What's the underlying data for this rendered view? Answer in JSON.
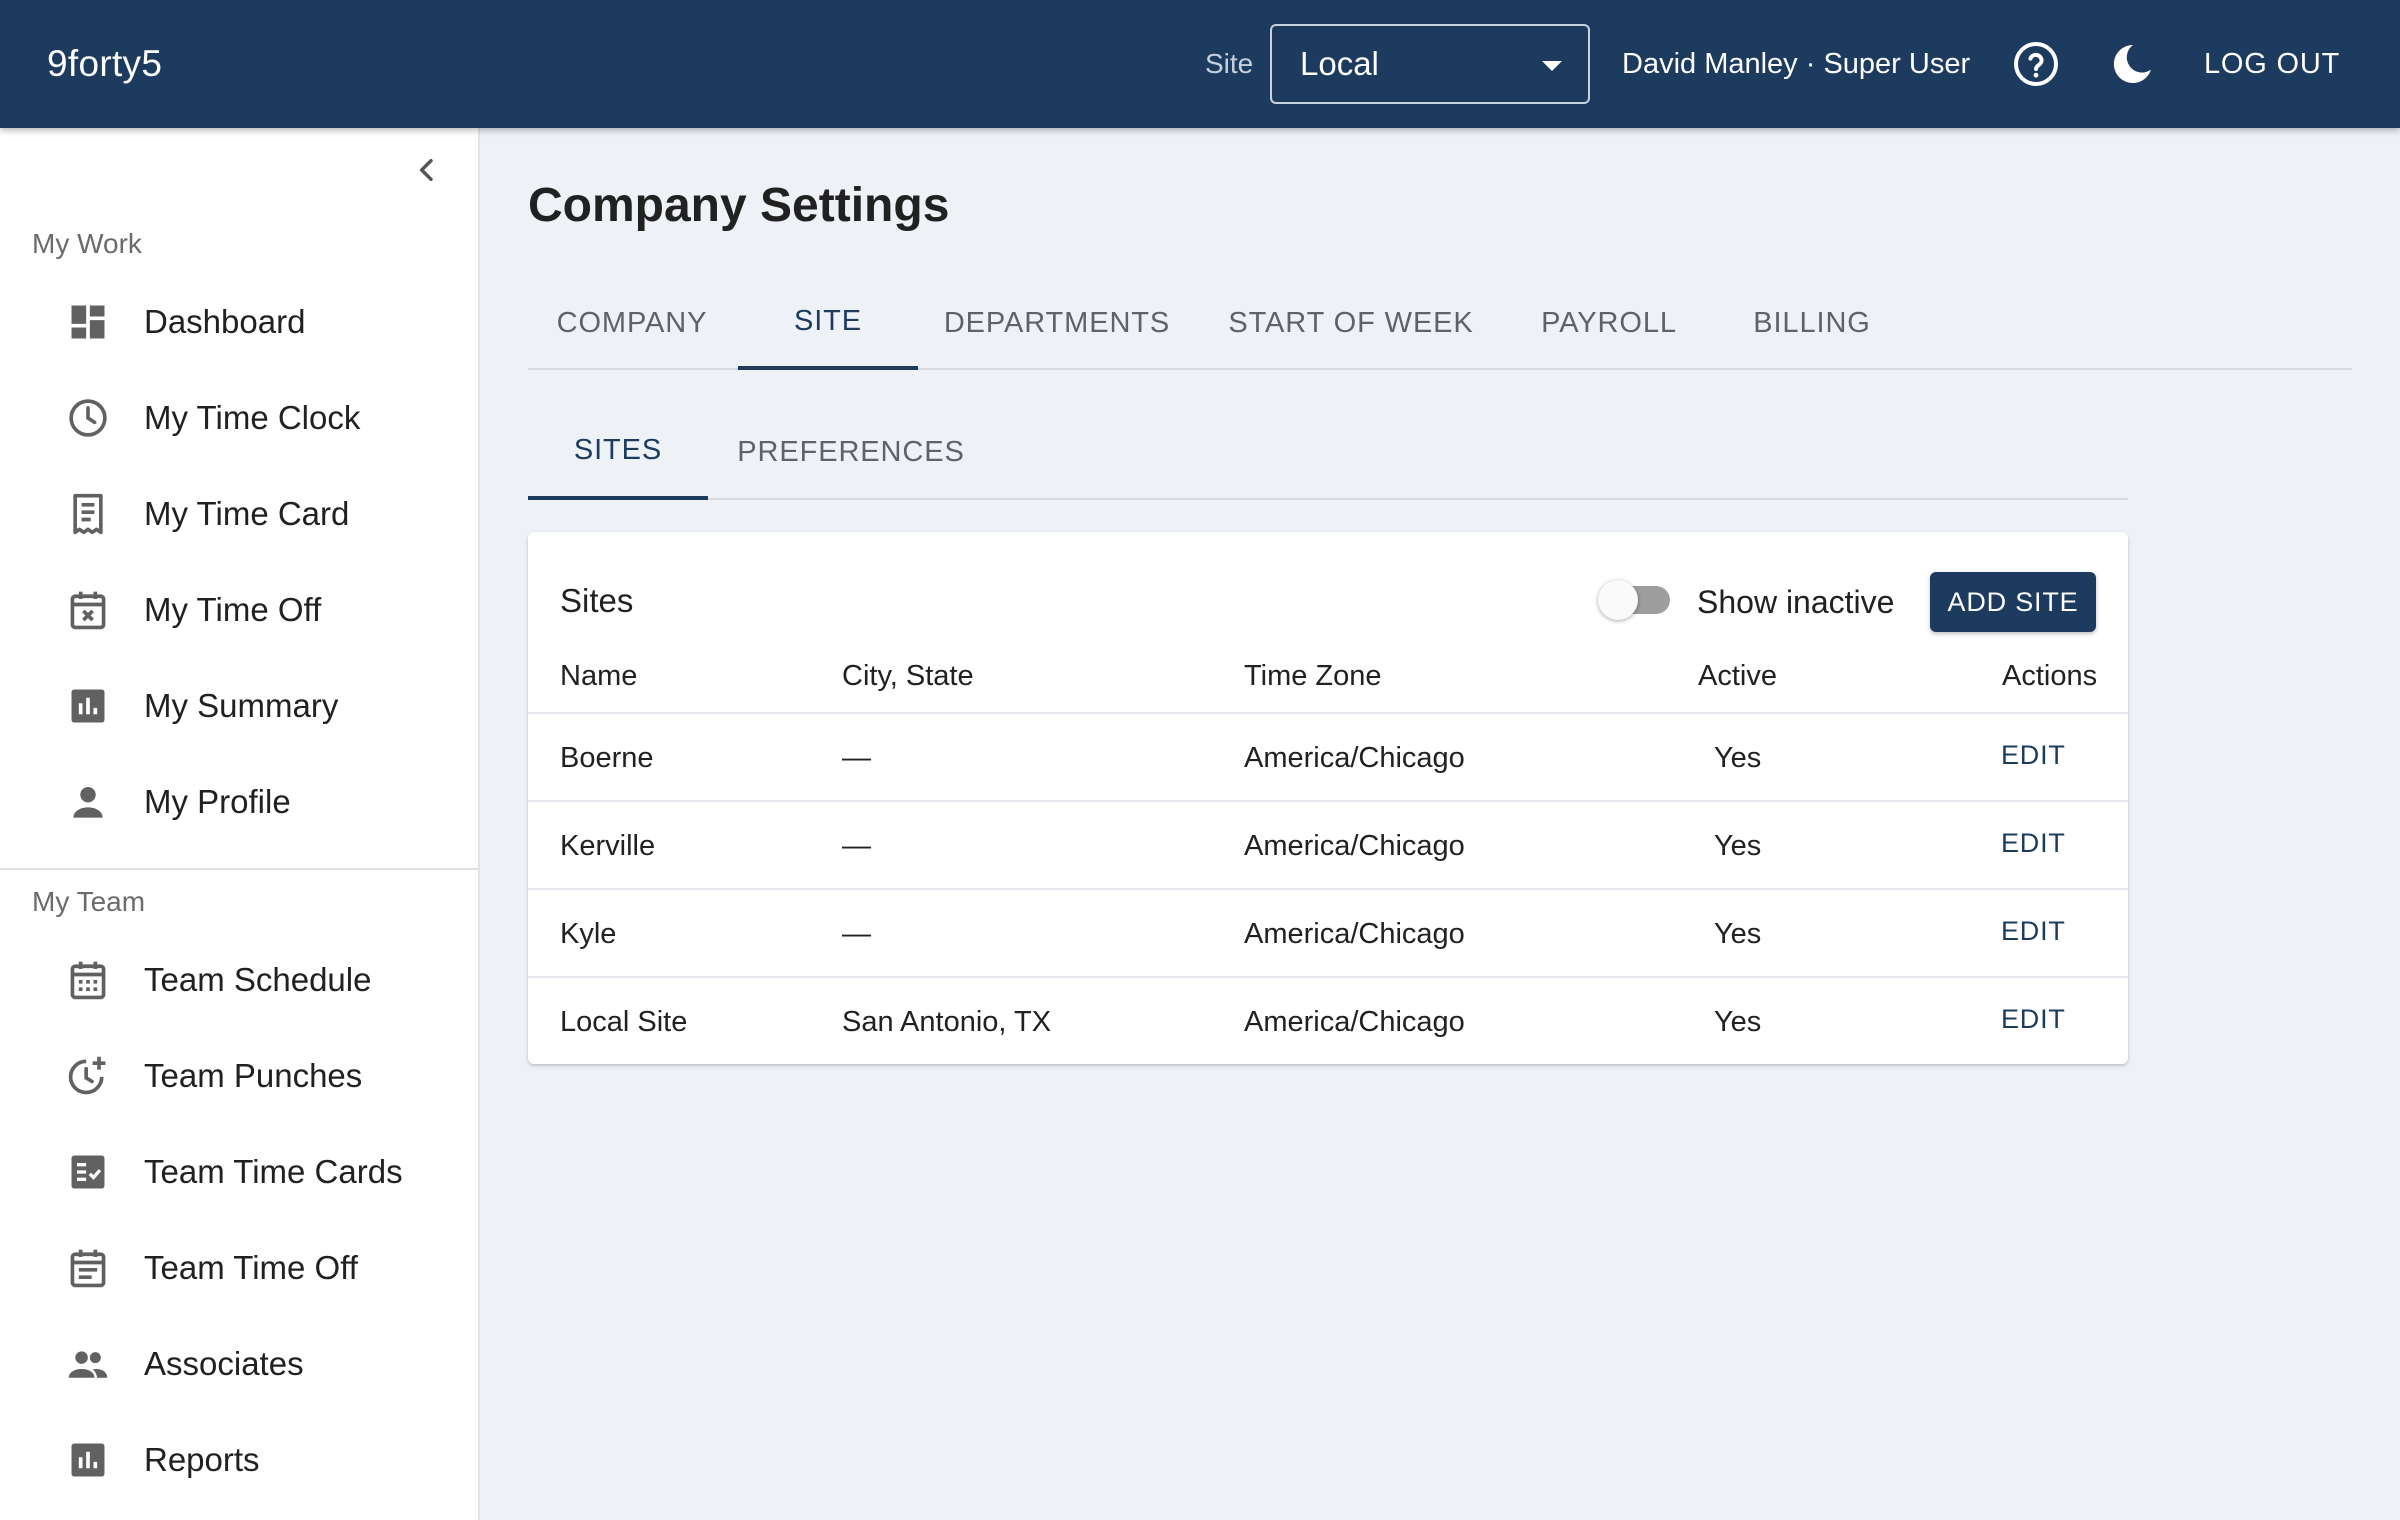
{
  "app": {
    "brand": "9forty5"
  },
  "header": {
    "site_label": "Site",
    "site_value": "Local",
    "user": "David Manley · Super User",
    "logout_label": "LOG OUT"
  },
  "sidebar": {
    "my_work_title": "My Work",
    "my_work": [
      {
        "label": "Dashboard",
        "icon": "dashboard-icon"
      },
      {
        "label": "My Time Clock",
        "icon": "clock-icon"
      },
      {
        "label": "My Time Card",
        "icon": "receipt-icon"
      },
      {
        "label": "My Time Off",
        "icon": "calendar-x-icon"
      },
      {
        "label": "My Summary",
        "icon": "bar-chart-icon"
      },
      {
        "label": "My Profile",
        "icon": "person-icon"
      }
    ],
    "my_team_title": "My Team",
    "my_team": [
      {
        "label": "Team Schedule",
        "icon": "calendar-grid-icon"
      },
      {
        "label": "Team Punches",
        "icon": "clock-plus-icon"
      },
      {
        "label": "Team Time Cards",
        "icon": "checklist-icon"
      },
      {
        "label": "Team Time Off",
        "icon": "calendar-list-icon"
      },
      {
        "label": "Associates",
        "icon": "people-icon"
      },
      {
        "label": "Reports",
        "icon": "bar-chart-icon"
      }
    ]
  },
  "main": {
    "title": "Company Settings",
    "tabs": [
      "COMPANY",
      "SITE",
      "DEPARTMENTS",
      "START OF WEEK",
      "PAYROLL",
      "BILLING"
    ],
    "active_tab": "SITE",
    "subtabs": [
      "SITES",
      "PREFERENCES"
    ],
    "active_subtab": "SITES"
  },
  "sites_card": {
    "title": "Sites",
    "show_inactive_label": "Show inactive",
    "show_inactive": false,
    "add_label": "ADD SITE",
    "columns": [
      "Name",
      "City, State",
      "Time Zone",
      "Active",
      "Actions"
    ],
    "rows": [
      {
        "name": "Boerne",
        "city": "—",
        "tz": "America/Chicago",
        "active": "Yes",
        "action": "EDIT"
      },
      {
        "name": "Kerville",
        "city": "—",
        "tz": "America/Chicago",
        "active": "Yes",
        "action": "EDIT"
      },
      {
        "name": "Kyle",
        "city": "—",
        "tz": "America/Chicago",
        "active": "Yes",
        "action": "EDIT"
      },
      {
        "name": "Local Site",
        "city": "San Antonio, TX",
        "tz": "America/Chicago",
        "active": "Yes",
        "action": "EDIT"
      }
    ]
  },
  "colors": {
    "primary": "#1d3a5f",
    "background": "#eef2f7"
  }
}
